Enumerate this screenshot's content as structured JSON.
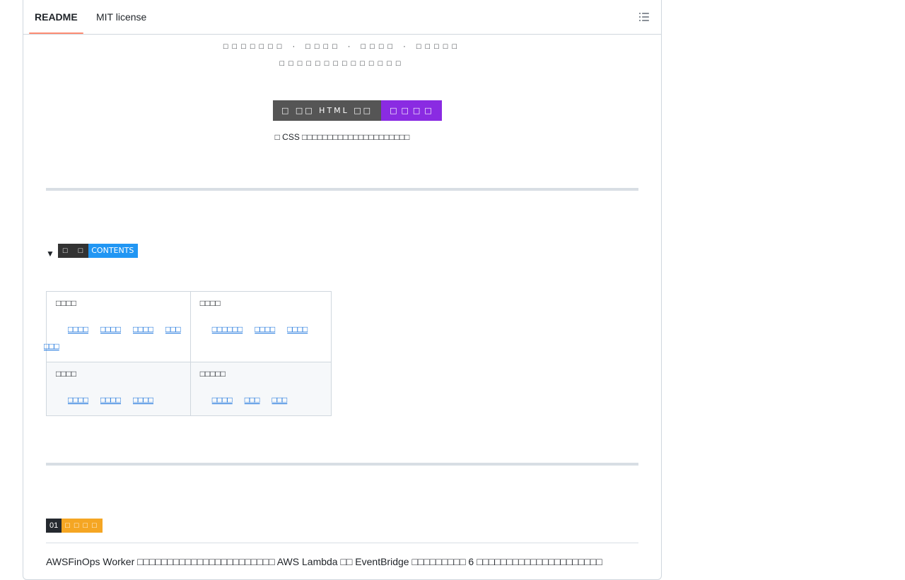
{
  "tabs": {
    "readme": "README",
    "license": "MIT license",
    "toc_icon": "list-unordered-icon"
  },
  "header": {
    "line1": "□□□□□□□ · □□□□ · □□□□ · □□□□□",
    "line2": "□□□□□□□□□□□□□□",
    "badge_left": "□ □□ HTML □□",
    "badge_right": "□□□□",
    "note": "□ CSS □□□□□□□□□□□□□□□□□□□□□"
  },
  "contents": {
    "label_left": "□ □",
    "label_right": "CONTENTS",
    "rows": [
      [
        {
          "title": "□□□□",
          "links": [
            "□□□□",
            "□□□□",
            "□□□□",
            "□□□",
            "□□□"
          ]
        },
        {
          "title": "□□□□",
          "links": [
            "□□□□□□",
            "□□□□",
            "□□□□"
          ]
        }
      ],
      [
        {
          "title": "□□□□",
          "links": [
            "□□□□",
            "□□□□",
            "□□□□"
          ]
        },
        {
          "title": "□□□□□",
          "links": [
            "□□□□",
            "□□□",
            "□□□"
          ]
        }
      ]
    ]
  },
  "section": {
    "number": "01",
    "label": "□□□□",
    "intro": "AWSFinOps Worker □□□□□□□□□□□□□□□□□□□□□□□ AWS Lambda □□ EventBridge □□□□□□□□□ 6 □□□□□□□□□□□□□□□□□□□□□"
  },
  "colors": {
    "tab_underline": "#fd8c73",
    "badge_purple": "#8a2be2",
    "badge_blue": "#2196f3",
    "badge_orange": "#f5a623",
    "link": "#0969da"
  }
}
